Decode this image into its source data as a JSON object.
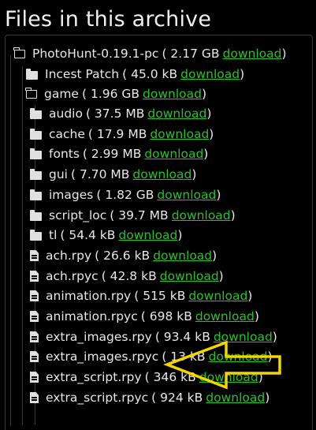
{
  "page": {
    "title": "Files in this archive"
  },
  "link_label": "download",
  "tree": {
    "root": {
      "name": "PhotoHunt-0.19.1-pc",
      "size": "2.17 GB"
    },
    "level1": [
      {
        "name": "Incest Patch",
        "size": "45.0 kB",
        "type": "folder"
      },
      {
        "name": "game",
        "size": "1.96 GB",
        "type": "folder-open"
      }
    ],
    "game_children": [
      {
        "name": "audio",
        "size": "37.5 MB",
        "type": "folder"
      },
      {
        "name": "cache",
        "size": "17.9 MB",
        "type": "folder"
      },
      {
        "name": "fonts",
        "size": "2.99 MB",
        "type": "folder"
      },
      {
        "name": "gui",
        "size": "7.70 MB",
        "type": "folder"
      },
      {
        "name": "images",
        "size": "1.82 GB",
        "type": "folder"
      },
      {
        "name": "script_loc",
        "size": "39.7 MB",
        "type": "folder"
      },
      {
        "name": "tl",
        "size": "54.4 kB",
        "type": "folder"
      },
      {
        "name": "ach.rpy",
        "size": "26.6 kB",
        "type": "file"
      },
      {
        "name": "ach.rpyc",
        "size": "42.8 kB",
        "type": "file"
      },
      {
        "name": "animation.rpy",
        "size": "515 kB",
        "type": "file"
      },
      {
        "name": "animation.rpyc",
        "size": "698 kB",
        "type": "file"
      },
      {
        "name": "extra_images.rpy",
        "size": "93.4 kB",
        "type": "file"
      },
      {
        "name": "extra_images.rpyc",
        "size": "13",
        "size_suffix": "kB",
        "type": "file"
      },
      {
        "name": "extra_script.rpy",
        "size": "346 kB",
        "type": "file"
      },
      {
        "name": "extra_script.rpyc",
        "size": "924 kB",
        "type": "file"
      }
    ]
  },
  "colors": {
    "link": "#27c227",
    "annotation": "#f2d600",
    "background": "#000000"
  }
}
